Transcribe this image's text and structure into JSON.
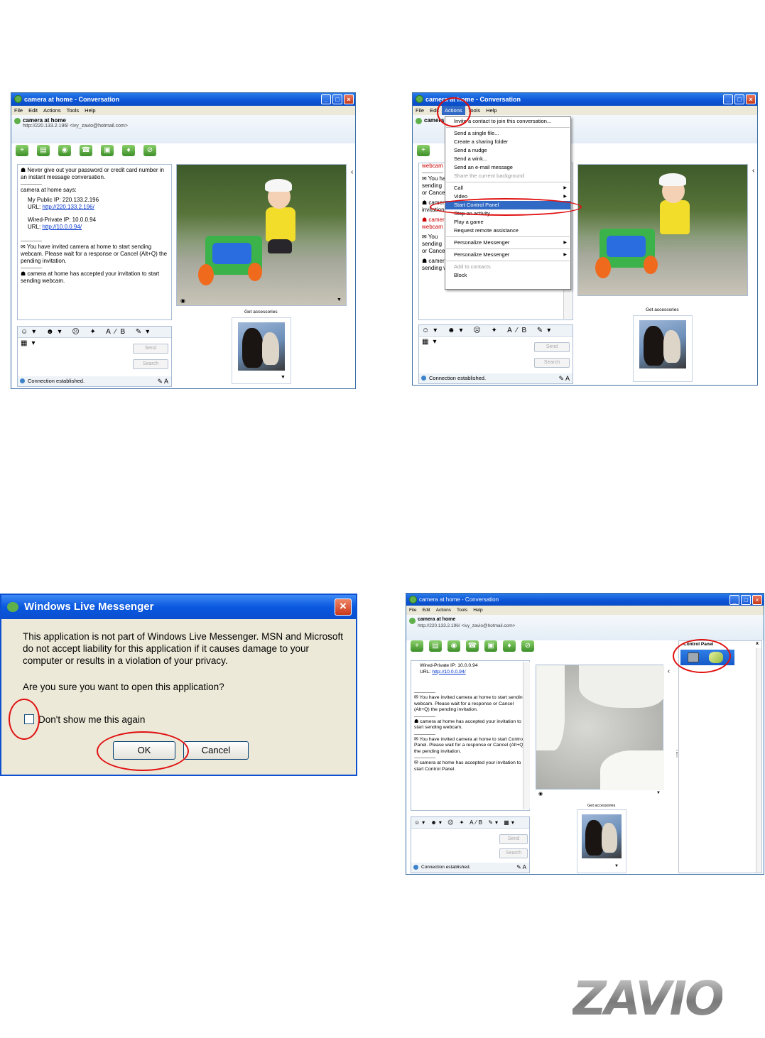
{
  "conversation": {
    "title": "camera at home - Conversation",
    "menu": [
      "File",
      "Edit",
      "Actions",
      "Tools",
      "Help"
    ],
    "contact_name": "camera at home",
    "contact_email": "http://220.133.2.196/ <ivy_zavio@hotmail.com>",
    "messages": {
      "warning": "Never give out your password or credit card number in an instant message conversation.",
      "says": "camera at home says:",
      "public_ip": "My Public IP: 220.133.2.196",
      "public_url_label": "URL: ",
      "public_url": "http://220.133.2.196/",
      "private_ip": "Wired-Private IP: 10.0.0.94",
      "private_url_label": "URL: ",
      "private_url": "http://10.0.0.94/",
      "invited_webcam": "You have invited camera at home to start sending webcam. Please wait for a response or Cancel (Alt+Q) the pending invitation.",
      "accepted_webcam": "camera at home has accepted your invitation to start sending webcam.",
      "invited_cp": "You have invited camera at home to start Control Panel. Please wait for a response or Cancel (Alt+Q) the pending invitation.",
      "accepted_cp": "camera at home has accepted your invitation to start Control Panel."
    },
    "send_label": "Send",
    "search_label": "Search",
    "status": "Connection established.",
    "accessories": "Get accessories",
    "emoticons": "☺▾ ☻▾ ☹ ✦   A⁄B ✎▾ ▦▾",
    "font_icons": "✎ A"
  },
  "actions_menu": {
    "items": [
      {
        "label": "Invite a contact to join this conversation...",
        "state": "normal"
      },
      {
        "sep": true
      },
      {
        "label": "Send a single file...",
        "state": "normal"
      },
      {
        "label": "Create a sharing folder",
        "state": "normal"
      },
      {
        "label": "Send a nudge",
        "state": "normal"
      },
      {
        "label": "Send a wink...",
        "state": "normal"
      },
      {
        "label": "Send an e-mail message",
        "state": "normal"
      },
      {
        "label": "Share the current background",
        "state": "disabled"
      },
      {
        "sep": true
      },
      {
        "label": "Call",
        "state": "normal",
        "arrow": true
      },
      {
        "label": "Video",
        "state": "normal",
        "arrow": true
      },
      {
        "label": "Start Control Panel",
        "state": "highlight"
      },
      {
        "label": "Stop an activity...",
        "state": "normal"
      },
      {
        "label": "Play a game",
        "state": "normal"
      },
      {
        "label": "Request remote assistance",
        "state": "normal"
      },
      {
        "sep": true
      },
      {
        "label": "Personalize Messenger",
        "state": "normal",
        "arrow": true
      },
      {
        "sep": true
      },
      {
        "label": "Personalize Messenger",
        "state": "normal",
        "arrow": true
      },
      {
        "sep": true
      },
      {
        "label": "Add to contacts",
        "state": "disabled"
      },
      {
        "label": "Block",
        "state": "normal"
      }
    ]
  },
  "dialog": {
    "title": "Windows Live Messenger",
    "body": "This application is not part of Windows Live Messenger. MSN and Microsoft do not accept liability for this application if it causes damage to your computer or results in a violation of your privacy.",
    "question": "Are you sure you want to open this application?",
    "checkbox": "Don't show me this again",
    "ok": "OK",
    "cancel": "Cancel"
  },
  "control_panel": {
    "title": "Control Panel",
    "close": "x"
  },
  "logo": "ZAVIO"
}
